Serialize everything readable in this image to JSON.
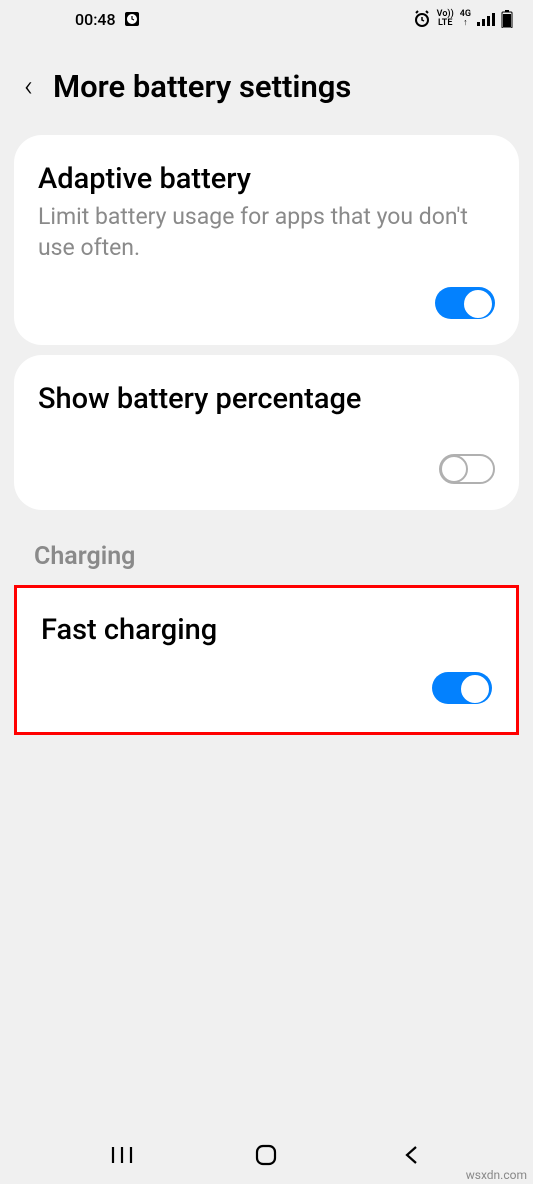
{
  "status": {
    "time": "00:48",
    "volte": "Vo))",
    "lte": "LTE",
    "net": "4G",
    "arrow": "↑"
  },
  "header": {
    "title": "More battery settings"
  },
  "settings": {
    "adaptive": {
      "title": "Adaptive battery",
      "desc": "Limit battery usage for apps that you don't use often."
    },
    "show_percentage": {
      "title": "Show battery percentage"
    },
    "charging_label": "Charging",
    "fast_charging": {
      "title": "Fast charging"
    }
  },
  "watermark": "wsxdn.com"
}
